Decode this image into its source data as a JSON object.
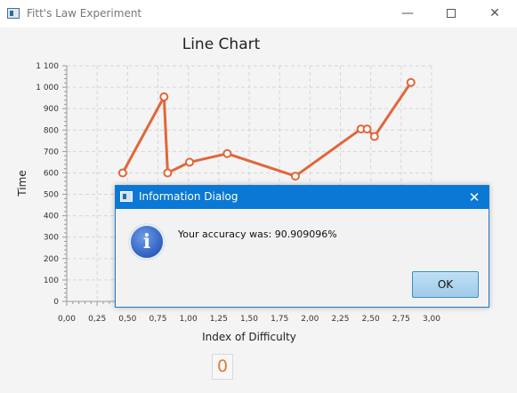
{
  "window": {
    "title": "Fitt's Law Experiment",
    "minimize_glyph": "—",
    "close_glyph": "✕",
    "icon": "app-window-icon"
  },
  "chart_data": {
    "type": "line",
    "title": "Line Chart",
    "xlabel": "Index of Difficulty",
    "ylabel": "Time",
    "xlim": [
      0,
      3
    ],
    "ylim": [
      0,
      1100
    ],
    "xticks": [
      "0,00",
      "0,25",
      "0,50",
      "0,75",
      "1,00",
      "1,25",
      "1,50",
      "1,75",
      "2,00",
      "2,25",
      "2,50",
      "2,75",
      "3,00"
    ],
    "yticks": [
      "0",
      "100",
      "200",
      "300",
      "400",
      "500",
      "600",
      "700",
      "800",
      "900",
      "1 000",
      "1 100"
    ],
    "grid": true,
    "color": "#e0673a",
    "series": [
      {
        "x": [
          0.46,
          0.8,
          0.83,
          1.01,
          1.32,
          1.88,
          2.42,
          2.47,
          2.53,
          2.83
        ],
        "y": [
          600,
          955,
          600,
          650,
          690,
          585,
          805,
          805,
          770,
          1022
        ]
      }
    ]
  },
  "counter": {
    "value": "0"
  },
  "dialog": {
    "title": "Information Dialog",
    "close_glyph": "✕",
    "icon": "info-icon",
    "icon_glyph": "i",
    "message": "Your accuracy was: 90.909096%",
    "ok_label": "OK",
    "accent_color": "#0a78d4"
  }
}
